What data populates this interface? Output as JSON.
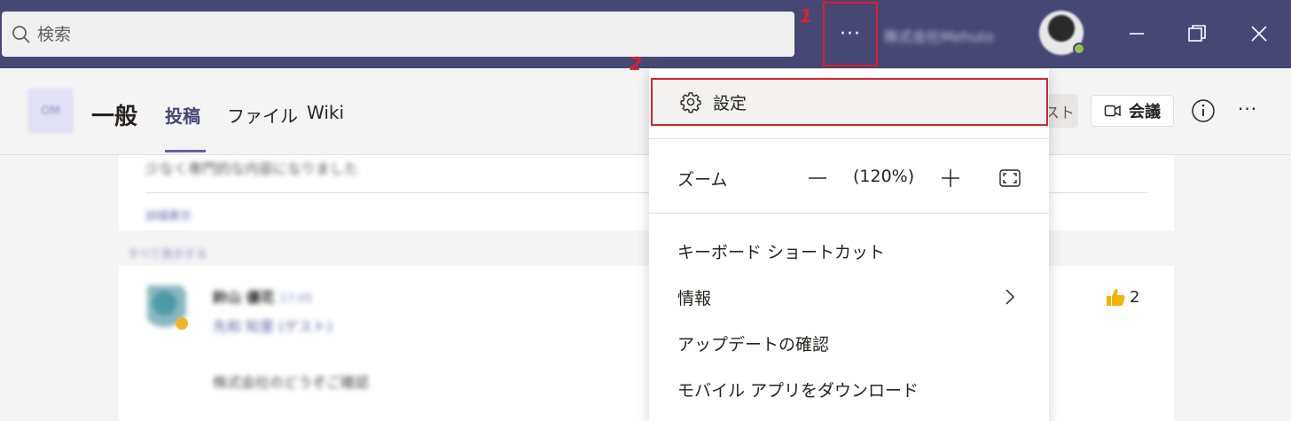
{
  "titlebar": {
    "search_placeholder": "検索",
    "more_label": "···",
    "org_name": "株式会社Mehuto",
    "annotation_1": "1",
    "annotation_2": "2"
  },
  "channel": {
    "team_initials": "OM",
    "name": "一般",
    "tabs": [
      {
        "label": "投稿",
        "active": true
      },
      {
        "label": "ファイル",
        "active": false
      },
      {
        "label": "Wiki",
        "active": false
      }
    ],
    "list_label": "スト",
    "meet_label": "会議",
    "more_label": "···"
  },
  "feed": {
    "line1": "少なく専門的な内容になりました",
    "line2": "詳細表示",
    "gap_label": "すべて表示する",
    "msg_name": "鈴山 優花",
    "msg_time": "17:05",
    "msg_sub": "先和 知里 (ゲスト)",
    "msg_body": "株式会社のどうぞご確認",
    "reaction_count": "2"
  },
  "menu": {
    "settings": "設定",
    "zoom_label": "ズーム",
    "zoom_level": "(120%)",
    "keyboard_shortcuts": "キーボード ショートカット",
    "info": "情報",
    "check_updates": "アップデートの確認",
    "download_mobile": "モバイル アプリをダウンロード"
  },
  "colors": {
    "titlebar": "#464775",
    "accent": "#6264a7",
    "highlight_border": "#e0202b"
  }
}
